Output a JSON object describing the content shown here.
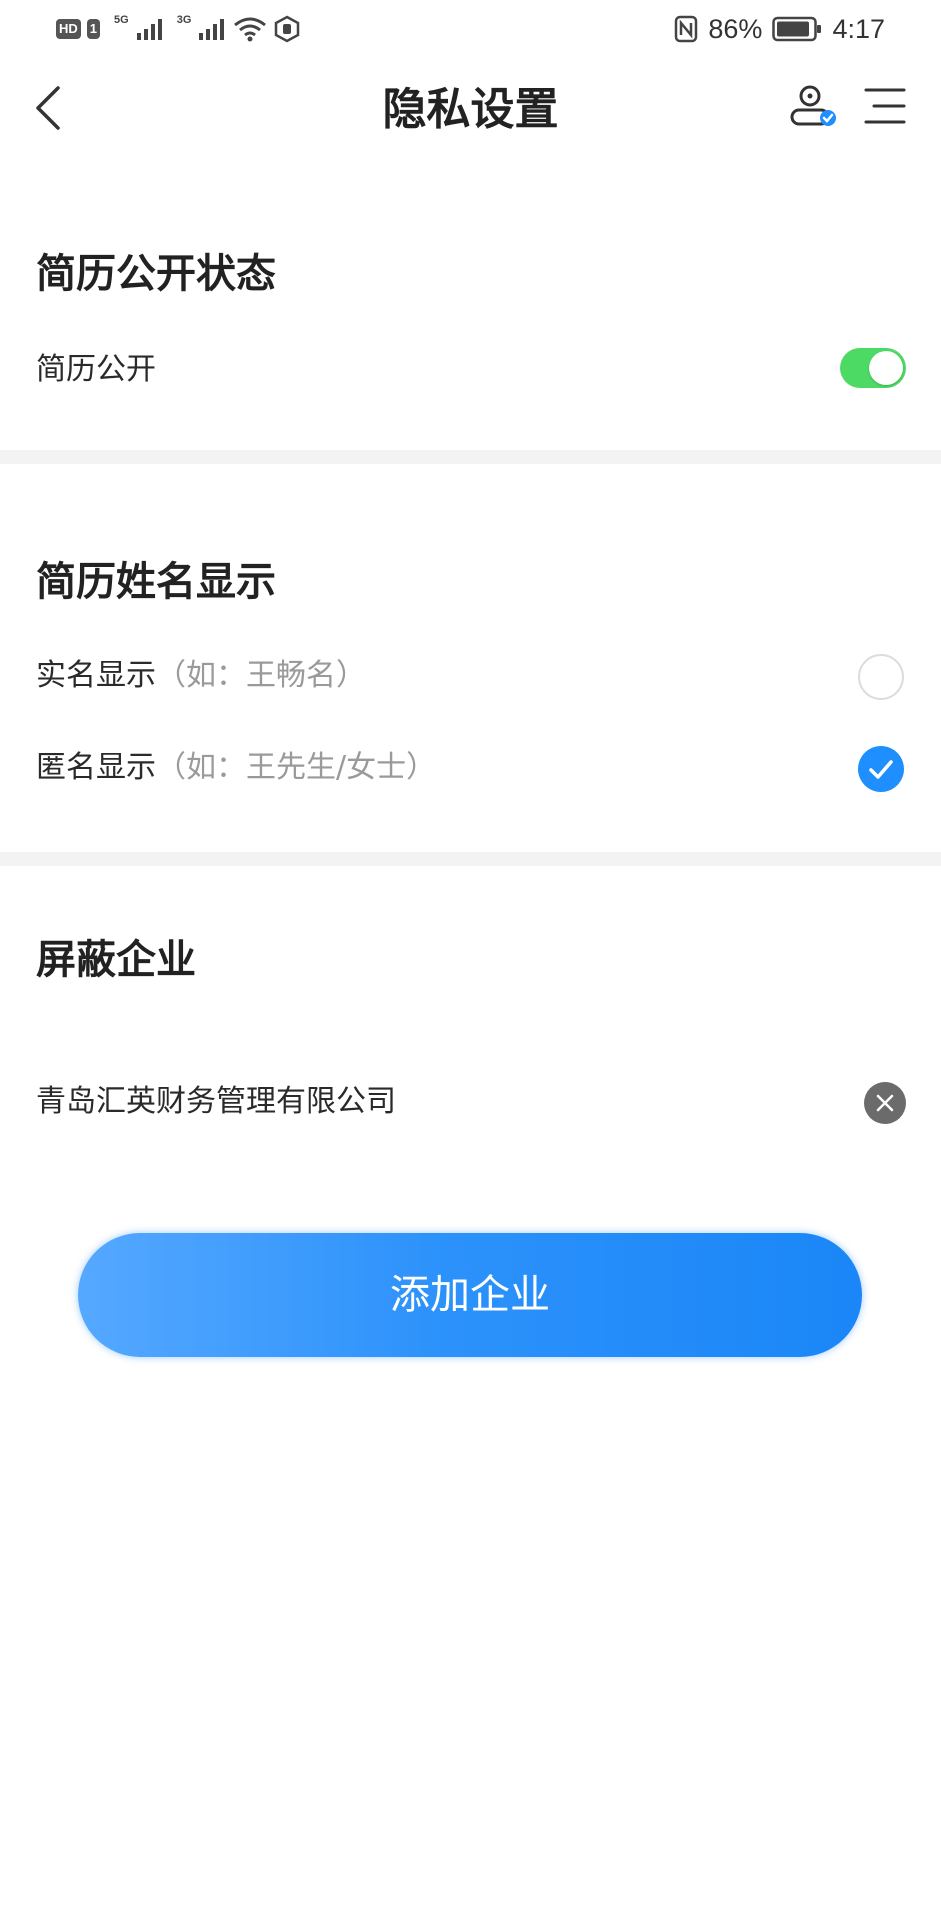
{
  "status_bar": {
    "badge_hd": "HD",
    "badge_sim": "1",
    "net_1": "5G",
    "net_2": "3G",
    "battery": "86%",
    "time": "4:17"
  },
  "header": {
    "title": "隐私设置"
  },
  "resume_public": {
    "section_title": "简历公开状态",
    "toggle_label": "简历公开",
    "toggle_on": true
  },
  "name_display": {
    "section_title": "简历姓名显示",
    "options": [
      {
        "label": "实名显示",
        "hint": "（如：王畅名）",
        "selected": false
      },
      {
        "label": "匿名显示",
        "hint": "（如：王先生/女士）",
        "selected": true
      }
    ]
  },
  "blocked_companies": {
    "section_title": "屏蔽企业",
    "items": [
      {
        "name": "青岛汇英财务管理有限公司"
      }
    ],
    "add_button_label": "添加企业"
  },
  "colors": {
    "toggle_on": "#4cd964",
    "radio_selected": "#1f8fff",
    "button_gradient_start": "#55a8ff",
    "button_gradient_end": "#1a86f7",
    "divider": "#f3f3f3"
  }
}
